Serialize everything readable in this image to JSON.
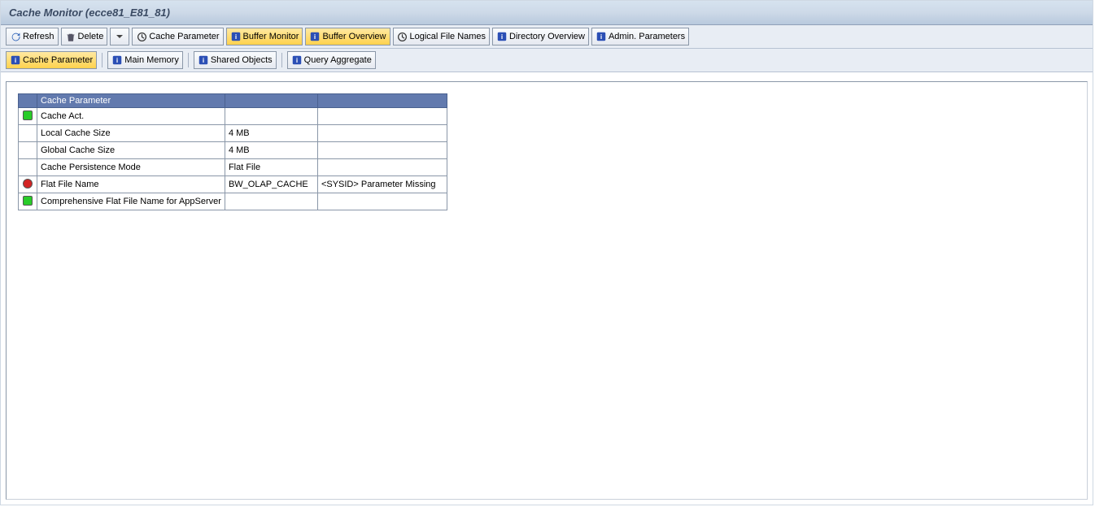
{
  "title": "Cache Monitor (ecce81_E81_81)",
  "toolbar1": {
    "refresh": "Refresh",
    "delete": "Delete",
    "cache_parameter": "Cache Parameter",
    "buffer_monitor": "Buffer Monitor",
    "buffer_overview": "Buffer Overview",
    "logical_file_names": "Logical File Names",
    "directory_overview": "Directory Overview",
    "admin_parameters": "Admin. Parameters"
  },
  "toolbar2": {
    "cache_parameter": "Cache Parameter",
    "main_memory": "Main Memory",
    "shared_objects": "Shared Objects",
    "query_aggregate": "Query Aggregate"
  },
  "table": {
    "header": {
      "icon": "",
      "param": "Cache Parameter",
      "val": "",
      "note": ""
    },
    "rows": [
      {
        "status": "green",
        "param": "Cache Act.",
        "val": "",
        "note": ""
      },
      {
        "status": "",
        "param": "Local Cache Size",
        "val": "4 MB",
        "note": ""
      },
      {
        "status": "",
        "param": "Global Cache Size",
        "val": "4 MB",
        "note": ""
      },
      {
        "status": "",
        "param": "Cache Persistence Mode",
        "val": "Flat File",
        "note": ""
      },
      {
        "status": "red",
        "param": "Flat File Name",
        "val": "BW_OLAP_CACHE",
        "note": "<SYSID> Parameter Missing"
      },
      {
        "status": "green",
        "param": "Comprehensive Flat File Name for AppServer",
        "val": "",
        "note": ""
      }
    ]
  }
}
